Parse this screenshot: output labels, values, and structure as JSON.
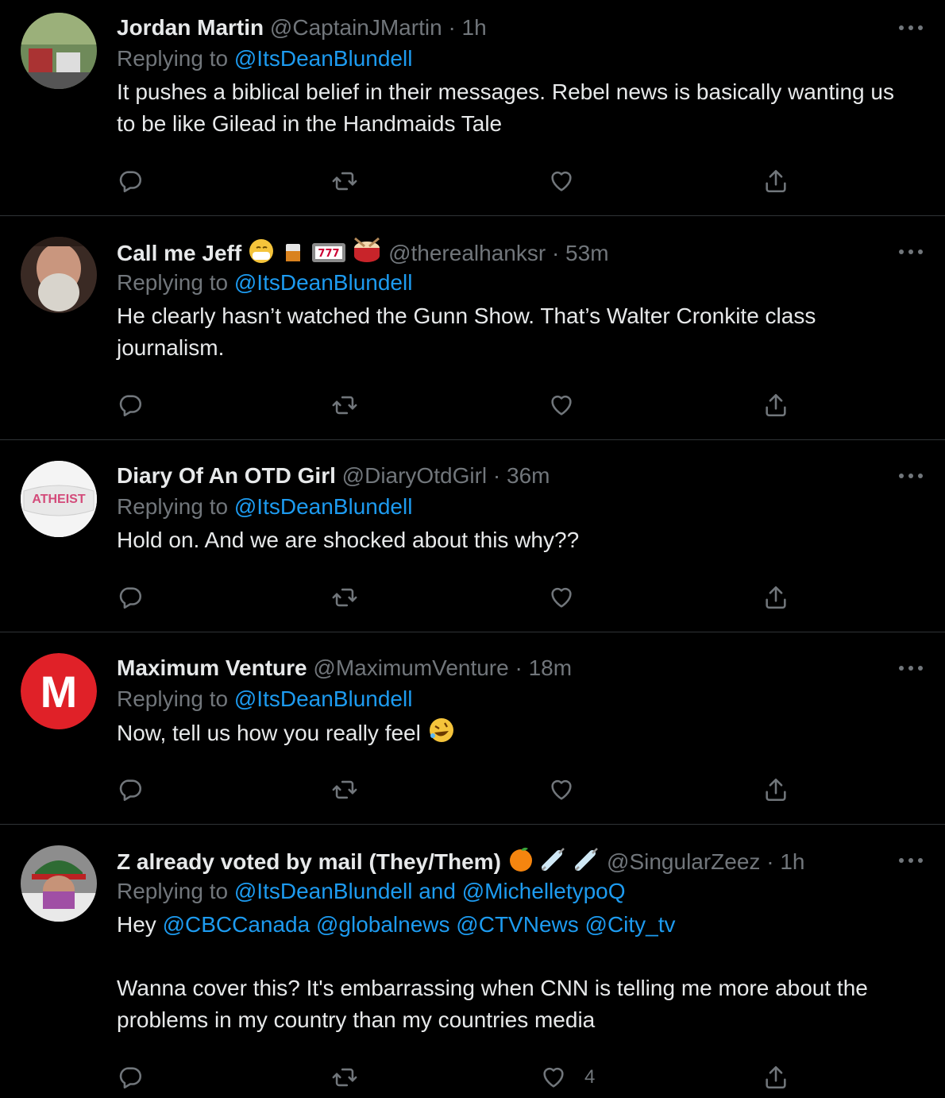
{
  "colors": {
    "background": "#000000",
    "text": "#e7e9ea",
    "muted": "#71767b",
    "link": "#1d9bf0",
    "divider": "#2f3336"
  },
  "tweets": [
    {
      "name": "Jordan Martin",
      "name_emojis": [],
      "handle": "@CaptainJMartin",
      "time": "1h",
      "replying_label": "Replying to",
      "replying_to": "@ItsDeanBlundell",
      "body": "It pushes a biblical belief in their messages. Rebel news is basically wanting us to be like Gilead in the Handmaids Tale",
      "like_count": ""
    },
    {
      "name": "Call me Jeff",
      "name_emojis": [
        "mask-face-emoji",
        "whisky-glass-emoji",
        "slot-machine-emoji",
        "drum-emoji"
      ],
      "handle": "@therealhanksr",
      "time": "53m",
      "replying_label": "Replying to",
      "replying_to": "@ItsDeanBlundell",
      "body": "He clearly hasn’t watched the Gunn Show. That’s Walter Cronkite class journalism.",
      "like_count": ""
    },
    {
      "name": "Diary Of An OTD Girl",
      "name_emojis": [],
      "handle": "@DiaryOtdGirl",
      "time": "36m",
      "replying_label": "Replying to",
      "replying_to": "@ItsDeanBlundell",
      "avatar_text": "ATHEIST",
      "body": "Hold on. And we are shocked about this why??",
      "like_count": ""
    },
    {
      "name": "Maximum Venture",
      "name_emojis": [],
      "handle": "@MaximumVenture",
      "time": "18m",
      "replying_label": "Replying to",
      "replying_to": "@ItsDeanBlundell",
      "avatar_text": "M",
      "body": "Now, tell us how you really feel",
      "body_emoji": "rolling-laughing-emoji",
      "like_count": ""
    },
    {
      "name": "Z already voted by mail (They/Them)",
      "name_emojis": [
        "orange-emoji",
        "syringe-emoji",
        "syringe-emoji"
      ],
      "handle": "@SingularZeez",
      "time": "1h",
      "replying_label": "Replying to",
      "replying_to": "@ItsDeanBlundell",
      "replying_and": "and",
      "replying_to_2": "@MichelletypoQ",
      "body_prefix": "Hey",
      "mentions": [
        "@CBCCanada",
        "@globalnews",
        "@CTVNews",
        "@City_tv"
      ],
      "body": "Wanna cover this? It's embarrassing when CNN is telling me more about the problems in  my country than my countries media",
      "like_count": "4"
    }
  ]
}
